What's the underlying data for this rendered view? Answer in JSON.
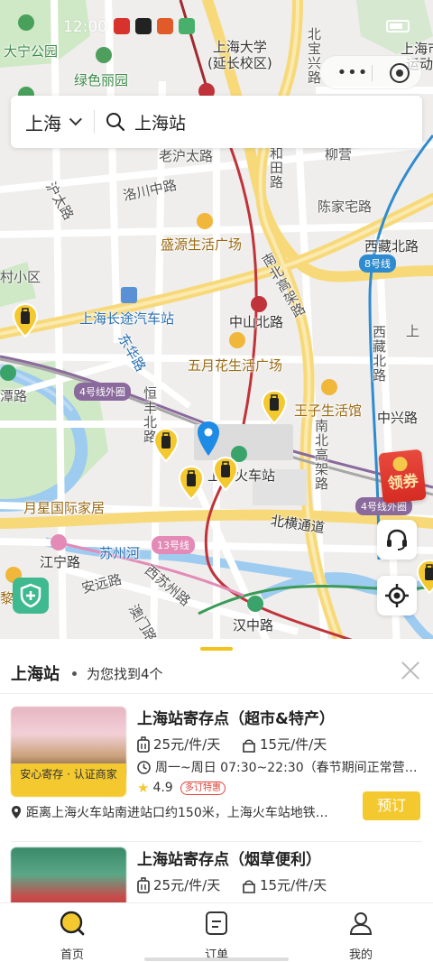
{
  "status_bar": {
    "time": "12:00"
  },
  "search": {
    "city": "上海",
    "query": "上海站"
  },
  "map": {
    "labels": {
      "dangning_park": "大宁公园",
      "lvse_liyuan": "绿色丽园",
      "shu_university": "上海大学\n(延长校区)",
      "shanghai_right": "上海市",
      "yundong": "运动",
      "beibao": "北宝兴路",
      "laohutai": "老沪太路",
      "luochuan_mid": "洛川中路",
      "hetian": "和田路",
      "liuying": "柳营",
      "chenjiazhai": "陈家宅路",
      "huzhou": "沪太路",
      "shengyuan": "盛源生活广场",
      "xizang_n": "西藏北路",
      "line8": "8号线",
      "nanbei_top": "南北高架路",
      "village": "村小区",
      "changtu": "上海长途汽车站",
      "zhongshan": "中山北路",
      "shangui": "上",
      "wuyue": "五月花生活广场",
      "dongjiang": "东华路",
      "xizang_n2": "西藏北路",
      "tanroad": "潭路",
      "line4": "4号线外圈",
      "wangzi": "王子生活馆",
      "zhongxing": "中兴路",
      "hengfeng": "恒丰北路",
      "nanbei_mid": "南北高架路",
      "station": "上海火车站",
      "line4b": "4号线外圈",
      "yuexing": "月星国际家居",
      "beiheng": "北横通道",
      "line13": "13号线",
      "jiangning": "江宁路",
      "suzhou_river": "苏州河",
      "anyuan": "安远路",
      "xisuzhou": "西苏州路",
      "li": "黎",
      "hanzhong": "汉中路",
      "aomen": "澳门路"
    },
    "coupon_label": "领券"
  },
  "sheet": {
    "title": "上海站",
    "count_text": "为您找到4个",
    "stores": [
      {
        "name": "上海站寄存点（超市&特产）",
        "price_small": "25元/件/天",
        "price_large": "15元/件/天",
        "hours": "周一~周日 07:30~22:30（春节期间正常营…",
        "rating": "4.9",
        "tag": "多订特惠",
        "badge": "安心寄存 · 认证商家",
        "address": "距离上海火车站南进站口约150米，上海火车站地铁…",
        "book_label": "预订"
      },
      {
        "name": "上海站寄存点（烟草便利）",
        "price_small": "25元/件/天",
        "price_large": "15元/件/天"
      }
    ]
  },
  "tabbar": {
    "home": "首页",
    "orders": "订单",
    "mine": "我的"
  },
  "colors": {
    "accent": "#f4c92f",
    "brand_green": "#3fb98f",
    "red_route": "#c0333a"
  }
}
